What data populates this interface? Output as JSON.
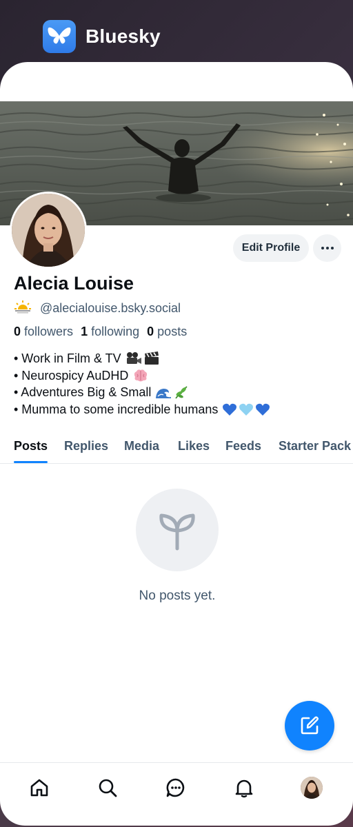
{
  "app_switcher": {
    "app_name": "Bluesky",
    "icon": "butterfly-icon"
  },
  "profile": {
    "display_name": "Alecia Louise",
    "handle_emoji": "sun-behind-cloud-icon",
    "handle": "@alecialouise.bsky.social",
    "edit_label": "Edit Profile",
    "more_icon": "ellipsis-icon",
    "stats": {
      "followers_count": "0",
      "followers_label": "followers",
      "following_count": "1",
      "following_label": "following",
      "posts_count": "0",
      "posts_label": "posts"
    },
    "bio": [
      {
        "text": "• Work in Film & TV",
        "emojis": [
          "movie-camera-icon",
          "clapper-board-icon"
        ]
      },
      {
        "text": "• Neurospicy AuDHD",
        "emojis": [
          "brain-icon"
        ]
      },
      {
        "text": "• Adventures Big & Small",
        "emojis": [
          "wave-icon",
          "herb-icon"
        ]
      },
      {
        "text": "• Mumma to some incredible humans",
        "emojis": [
          "blue-heart-icon",
          "light-blue-heart-icon",
          "blue-heart-icon"
        ]
      }
    ]
  },
  "tabs": [
    {
      "label": "Posts",
      "active": true
    },
    {
      "label": "Replies"
    },
    {
      "label": "Media"
    },
    {
      "label": "Likes"
    },
    {
      "label": "Feeds"
    },
    {
      "label": "Starter Pack"
    }
  ],
  "feed": {
    "empty_icon": "sprout-icon",
    "empty_text": "No posts yet."
  },
  "fab": {
    "icon": "compose-icon"
  },
  "bottom_nav": [
    {
      "icon": "home-icon"
    },
    {
      "icon": "search-icon"
    },
    {
      "icon": "chat-icon"
    },
    {
      "icon": "bell-icon"
    },
    {
      "icon": "profile-avatar"
    }
  ],
  "colors": {
    "accent": "#1083fe",
    "text_primary": "#0b0f14",
    "text_secondary": "#42576c",
    "button_bg": "#f1f3f5"
  }
}
